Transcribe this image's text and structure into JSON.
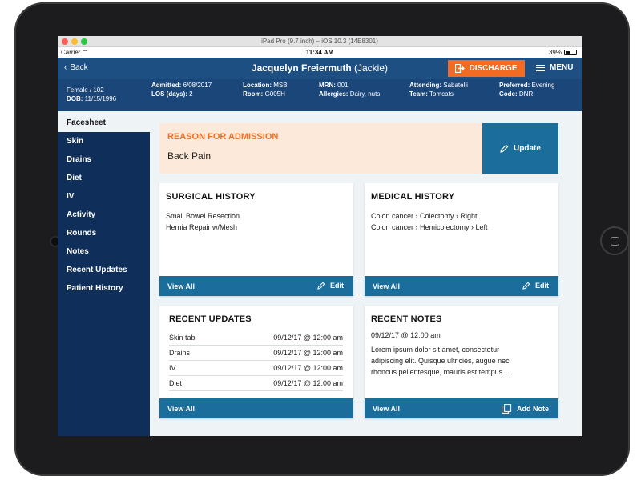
{
  "simulator": {
    "title": "iPad Pro (9.7 inch) – iOS 10.3 (14E8301)",
    "dot_colors": [
      "#fe5f57",
      "#febc2e",
      "#28c840"
    ]
  },
  "status_bar": {
    "carrier": "Carrier",
    "time": "11:34 AM",
    "battery": "39%",
    "battery_level": 0.39
  },
  "nav": {
    "back_label": "Back",
    "patient_name": "Jacquelyn Freiermuth",
    "patient_nickname": "(Jackie)",
    "discharge_label": "DISCHARGE",
    "menu_label": "MENU"
  },
  "patient_info": {
    "gender_room": "Female / 102",
    "dob_label": "DOB:",
    "dob": "11/15/1996",
    "admitted_label": "Admitted:",
    "admitted": "6/08/2017",
    "los_label": "LOS (days):",
    "los": "2",
    "location_label": "Location:",
    "location": "MSB",
    "room_label": "Room:",
    "room": "G005H",
    "mrn_label": "MRN:",
    "mrn": "001",
    "allergies_label": "Allergies:",
    "allergies": "Dairy, nuts",
    "attending_label": "Attending:",
    "attending": "Sabatelli",
    "team_label": "Team:",
    "team": "Tomcats",
    "preferred_label": "Preferred:",
    "preferred": "Evening",
    "code_label": "Code:",
    "code": "DNR"
  },
  "sidebar": {
    "items": [
      {
        "label": "Facesheet"
      },
      {
        "label": "Skin"
      },
      {
        "label": "Drains"
      },
      {
        "label": "Diet"
      },
      {
        "label": "IV"
      },
      {
        "label": "Activity"
      },
      {
        "label": "Rounds"
      },
      {
        "label": "Notes"
      },
      {
        "label": "Recent Updates"
      },
      {
        "label": "Patient History"
      }
    ]
  },
  "reason": {
    "title": "REASON FOR ADMISSION",
    "value": "Back Pain",
    "update_label": "Update"
  },
  "surgical_history": {
    "title": "SURGICAL HISTORY",
    "items": [
      "Small Bowel Resection",
      "Hernia Repair w/Mesh"
    ],
    "view_all": "View All",
    "edit": "Edit"
  },
  "medical_history": {
    "title": "MEDICAL HISTORY",
    "items": [
      "Colon cancer › Colectomy › Right",
      "Colon cancer › Hemicolectomy › Left"
    ],
    "view_all": "View All",
    "edit": "Edit"
  },
  "recent_updates": {
    "title": "RECENT UPDATES",
    "rows": [
      {
        "name": "Skin tab",
        "when": "09/12/17 @ 12:00 am"
      },
      {
        "name": "Drains",
        "when": "09/12/17 @ 12:00 am"
      },
      {
        "name": "IV",
        "when": "09/12/17 @ 12:00 am"
      },
      {
        "name": "Diet",
        "when": "09/12/17 @ 12:00 am"
      }
    ],
    "view_all": "View All"
  },
  "recent_notes": {
    "title": "RECENT NOTES",
    "date": "09/12/17 @ 12:00 am",
    "lines": [
      "Lorem ipsum dolor sit amet, consectetur",
      "adipiscing elit. Quisque ultricies, augue nec",
      "rhoncus pellentesque, mauris est tempus ..."
    ],
    "view_all": "View All",
    "add_note": "Add Note"
  },
  "colors": {
    "nav_blue": "#1d4f82",
    "sidebar_navy": "#0f2f5a",
    "accent_orange": "#f26b22",
    "footer_blue": "#1b6e9b"
  }
}
